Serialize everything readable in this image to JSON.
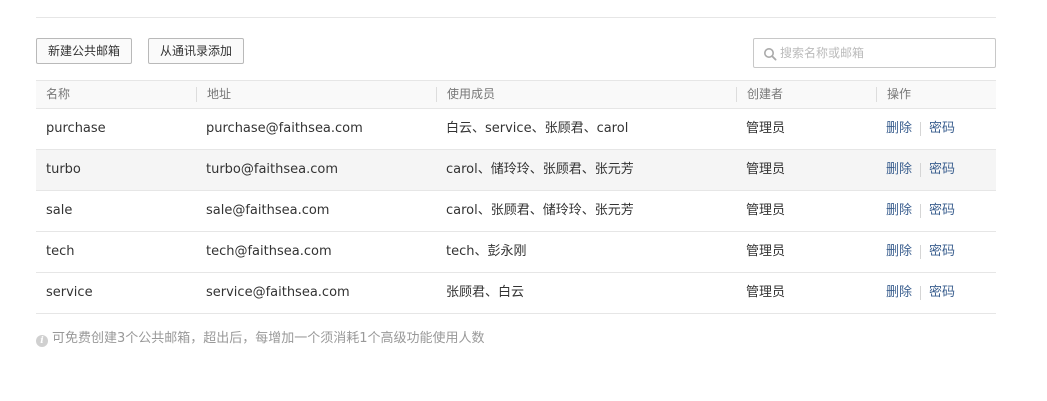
{
  "toolbar": {
    "new_button": "新建公共邮箱",
    "contacts_button": "从通讯录添加",
    "search_placeholder": "搜索名称或邮箱"
  },
  "table": {
    "headers": [
      "名称",
      "地址",
      "使用成员",
      "创建者",
      "操作"
    ],
    "rows": [
      {
        "name": "purchase",
        "address": "purchase@faithsea.com",
        "members": "白云、service、张顾君、carol",
        "creator": "管理员",
        "delete": "删除",
        "password": "密码"
      },
      {
        "name": "turbo",
        "address": "turbo@faithsea.com",
        "members": "carol、储玲玲、张顾君、张元芳",
        "creator": "管理员",
        "delete": "删除",
        "password": "密码"
      },
      {
        "name": "sale",
        "address": "sale@faithsea.com",
        "members": "carol、张顾君、储玲玲、张元芳",
        "creator": "管理员",
        "delete": "删除",
        "password": "密码"
      },
      {
        "name": "tech",
        "address": "tech@faithsea.com",
        "members": "tech、彭永刚",
        "creator": "管理员",
        "delete": "删除",
        "password": "密码"
      },
      {
        "name": "service",
        "address": "service@faithsea.com",
        "members": "张顾君、白云",
        "creator": "管理员",
        "delete": "删除",
        "password": "密码"
      }
    ]
  },
  "note": {
    "icon": "info-icon",
    "text": "可免费创建3个公共邮箱，超出后，每增加一个须消耗1个高级功能使用人数"
  },
  "colors": {
    "action_link": "#3b5f8f",
    "alt_row_bg": "#f5f5f5",
    "header_bg": "#f9f9f9"
  }
}
